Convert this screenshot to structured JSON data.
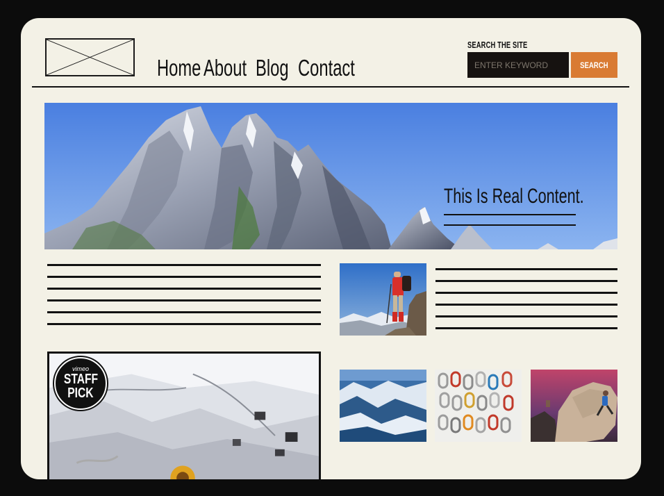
{
  "header": {
    "logo": "logo-placeholder",
    "nav": [
      {
        "label": "Home"
      },
      {
        "label": "About"
      },
      {
        "label": "Blog"
      },
      {
        "label": "Contact"
      }
    ],
    "search": {
      "label": "SEARCH THE SITE",
      "placeholder": "ENTER KEYWORD",
      "button_label": "SEARCH",
      "accent_color": "#d97b33"
    }
  },
  "hero": {
    "headline": "This Is Real Content.",
    "image": "mountain-peaks-photo"
  },
  "content": {
    "left_text_lines": 6,
    "right_text_lines": 6,
    "images": [
      "climber-on-summit-photo",
      "snowy-mountain-range-photo",
      "climbing-carabiners-photo",
      "bouldering-climber-photo"
    ]
  },
  "video": {
    "badge_brand": "vimeo",
    "badge_line1": "STAFF",
    "badge_line2": "PICK"
  },
  "colors": {
    "page_bg": "#f3f1e6",
    "outer_bg": "#0c0c0c",
    "search_field": "#161210",
    "ink": "#111111"
  }
}
